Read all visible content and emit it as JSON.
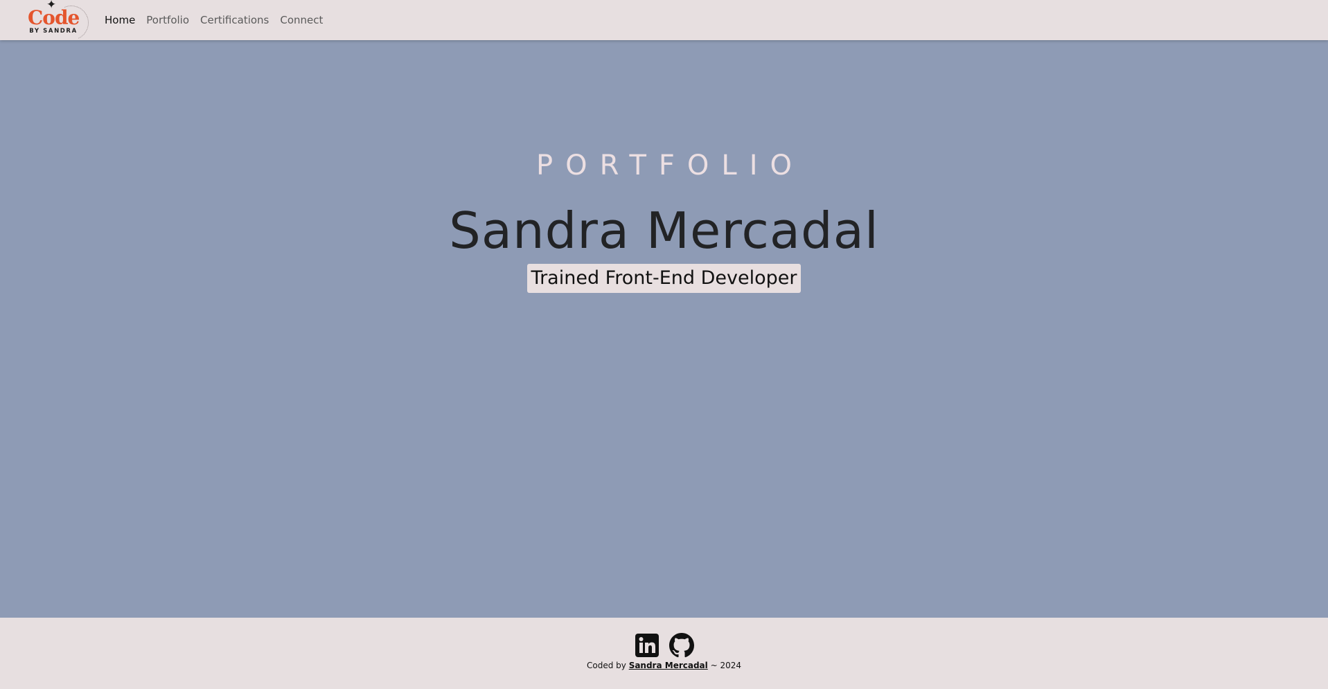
{
  "nav": {
    "logo": {
      "word": "Code",
      "sub": "BY SANDRA"
    },
    "links": [
      {
        "label": "Home",
        "active": true
      },
      {
        "label": "Portfolio",
        "active": false
      },
      {
        "label": "Certifications",
        "active": false
      },
      {
        "label": "Connect",
        "active": false
      }
    ]
  },
  "hero": {
    "eyebrow": "PORTFOLIO",
    "name": "Sandra Mercadal",
    "tagline": "Trained Front-End Developer"
  },
  "footer": {
    "social": [
      {
        "icon": "linkedin-icon"
      },
      {
        "icon": "github-icon"
      }
    ],
    "credit_prefix": "Coded by ",
    "credit_name": "Sandra Mercadal",
    "credit_suffix": " ~ 2024"
  },
  "colors": {
    "hero_bg": "#8e9bb5",
    "nav_bg": "#e7dfe0",
    "logo_accent": "#e4552d"
  }
}
